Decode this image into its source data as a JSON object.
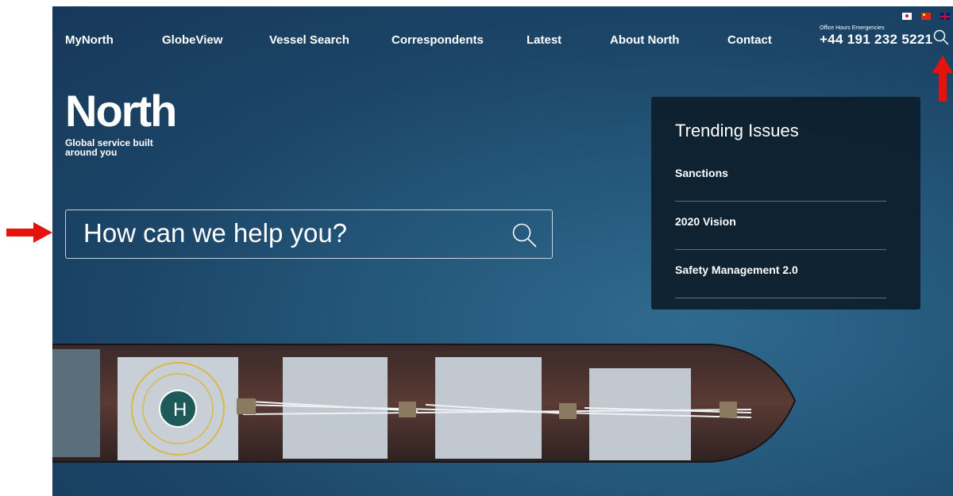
{
  "nav": {
    "items": [
      "MyNorth",
      "GlobeView",
      "Vessel Search",
      "Correspondents",
      "Latest",
      "About North",
      "Contact"
    ],
    "phone_label": "Office Hours Emergencies",
    "phone": "+44 191 232 5221",
    "search_icon": "search-icon",
    "flags": [
      "japan-flag-icon",
      "china-flag-icon",
      "uk-flag-icon"
    ]
  },
  "logo": {
    "wordmark": "North",
    "tagline": "Global service built around you"
  },
  "search": {
    "placeholder": "How can we help you?",
    "icon": "search-icon"
  },
  "trending": {
    "title": "Trending Issues",
    "items": [
      "Sanctions",
      "2020 Vision",
      "Safety Management 2.0"
    ]
  },
  "colors": {
    "sea": "#1f4b6e",
    "panel": "#0d1e2c",
    "annotation_arrow": "#e8120c"
  }
}
